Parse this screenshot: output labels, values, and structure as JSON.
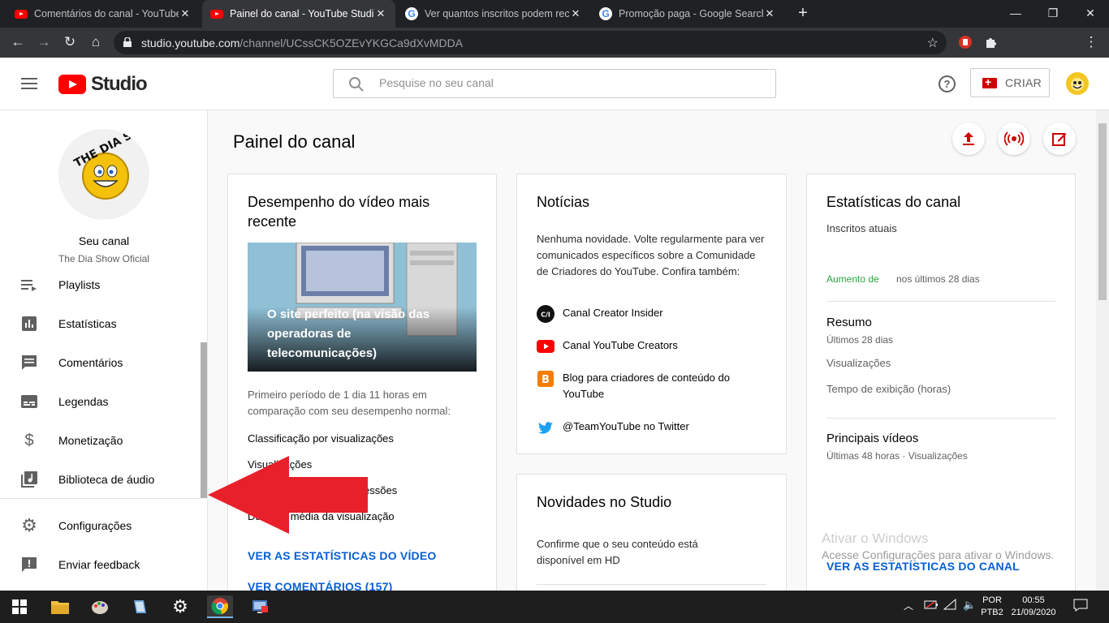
{
  "browser": {
    "tabs": [
      {
        "title": "Comentários do canal - YouTube",
        "favicon": "youtube-icon"
      },
      {
        "title": "Painel do canal - YouTube Studio",
        "favicon": "youtube-icon"
      },
      {
        "title": "Ver quantos inscritos podem rece",
        "favicon": "google-icon"
      },
      {
        "title": "Promoção paga - Google Search",
        "favicon": "google-icon"
      }
    ],
    "url_host": "studio.youtube.com",
    "url_path": "/channel/UCssCK5OZEvYKGCa9dXvMDDA"
  },
  "header": {
    "logo_text": "Studio",
    "search_placeholder": "Pesquise no seu canal",
    "help_glyph": "?",
    "create_label": "CRIAR"
  },
  "sidebar": {
    "channel_label": "Seu canal",
    "channel_name": "The Dia Show Oficial",
    "avatar_text": "THE DIA SHOW",
    "items": [
      {
        "label": "Playlists",
        "icon": "playlist-icon"
      },
      {
        "label": "Estatísticas",
        "icon": "analytics-icon"
      },
      {
        "label": "Comentários",
        "icon": "comments-icon"
      },
      {
        "label": "Legendas",
        "icon": "subtitles-icon"
      },
      {
        "label": "Monetização",
        "icon": "dollar-icon"
      },
      {
        "label": "Biblioteca de áudio",
        "icon": "audio-library-icon"
      },
      {
        "label": "Configurações",
        "icon": "gear-icon"
      },
      {
        "label": "Enviar feedback",
        "icon": "feedback-icon"
      }
    ]
  },
  "main": {
    "page_title": "Painel do canal",
    "latest_video": {
      "title": "Desempenho do vídeo mais recente",
      "video_title": "O site perfeito (na visão das operadoras de telecomunicações)",
      "period_text": "Primeiro período de 1 dia 11 horas em comparação com seu desempenho normal:",
      "rows": [
        "Classificação por visualizações",
        "Visualizações",
        "Taxa de cliques das impressões",
        "Duração média da visualização"
      ],
      "link_stats": "VER AS ESTATÍSTICAS DO VÍDEO",
      "link_comments": "VER COMENTÁRIOS (157)"
    },
    "news": {
      "title": "Notícias",
      "text": "Nenhuma novidade. Volte regularmente para ver comunicados específicos sobre a Comunidade de Criadores do YouTube. Confira também:",
      "items": [
        {
          "label": "Canal Creator Insider",
          "icon": "creator-insider-icon",
          "badge": "C/I"
        },
        {
          "label": "Canal YouTube Creators",
          "icon": "youtube-icon"
        },
        {
          "label": "Blog para criadores de conteúdo do YouTube",
          "icon": "blogger-icon",
          "badge": "B"
        },
        {
          "label": "@TeamYouTube no Twitter",
          "icon": "twitter-icon"
        }
      ]
    },
    "studio_news": {
      "title": "Novidades no Studio",
      "text": "Confirme que o seu conteúdo está disponível em HD"
    },
    "channel_stats": {
      "title": "Estatísticas do canal",
      "subscribers_label": "Inscritos atuais",
      "increase_label": "Aumento de",
      "increase_period": "nos últimos 28 dias",
      "summary_title": "Resumo",
      "summary_period": "Últimos 28 dias",
      "views_label": "Visualizações",
      "watch_time_label": "Tempo de exibição (horas)",
      "top_videos_title": "Principais vídeos",
      "top_videos_period": "Últimas 48 horas · Visualizações",
      "link": "VER AS ESTATÍSTICAS DO CANAL"
    }
  },
  "watermark": {
    "line1": "Ativar o Windows",
    "line2": "Acesse Configurações para ativar o Windows."
  },
  "taskbar": {
    "lang_top": "POR",
    "lang_bottom": "PTB2",
    "time": "00:55",
    "date": "21/09/2020"
  },
  "colors": {
    "brand_red": "#ff0000",
    "link_blue": "#065fd4",
    "increase_green": "#2ba640",
    "arrow_red": "#e8202a"
  }
}
